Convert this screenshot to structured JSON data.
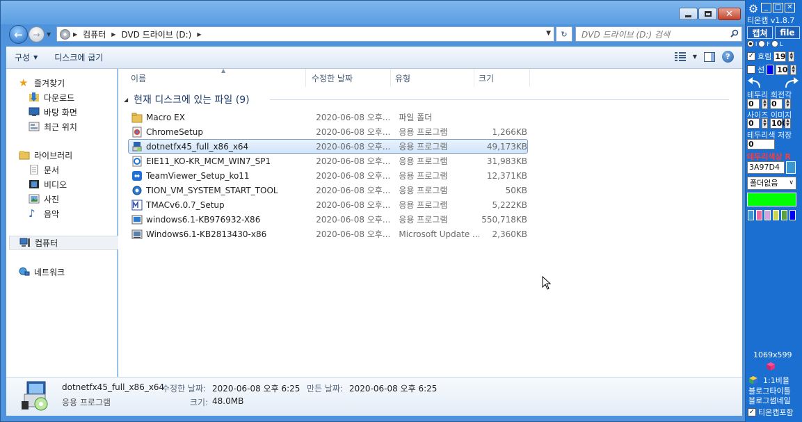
{
  "window": {
    "caption_buttons": [
      "minimize",
      "maximize",
      "close"
    ]
  },
  "address": {
    "crumbs": [
      "컴퓨터",
      "DVD 드라이브 (D:)"
    ],
    "search_placeholder": "DVD 드라이브 (D:) 검색"
  },
  "toolbar": {
    "organize": "구성",
    "burn": "디스크에 굽기"
  },
  "nav": {
    "favorites": "즐겨찾기",
    "downloads": "다운로드",
    "desktop": "바탕 화면",
    "recent": "최근 위치",
    "libraries": "라이브러리",
    "documents": "문서",
    "videos": "비디오",
    "pictures": "사진",
    "music": "음악",
    "computer": "컴퓨터",
    "network": "네트워크"
  },
  "columns": {
    "name": "이름",
    "modified": "수정한 날짜",
    "type": "유형",
    "size": "크기"
  },
  "group": {
    "title": "현재 디스크에 있는 파일 (9)"
  },
  "files": [
    {
      "name": "Macro EX",
      "date": "2020-06-08 오후...",
      "type": "파일 폴더",
      "size": "",
      "icon": "folder-icon"
    },
    {
      "name": "ChromeSetup",
      "date": "2020-06-08 오후...",
      "type": "응용 프로그램",
      "size": "1,266KB",
      "icon": "chrome-setup-icon"
    },
    {
      "name": "dotnetfx45_full_x86_x64",
      "date": "2020-06-08 오후...",
      "type": "응용 프로그램",
      "size": "49,173KB",
      "icon": "installer-icon"
    },
    {
      "name": "EIE11_KO-KR_MCM_WIN7_SP1",
      "date": "2020-06-08 오후...",
      "type": "응용 프로그램",
      "size": "31,983KB",
      "icon": "ie-setup-icon"
    },
    {
      "name": "TeamViewer_Setup_ko11",
      "date": "2020-06-08 오후...",
      "type": "응용 프로그램",
      "size": "12,371KB",
      "icon": "teamviewer-icon"
    },
    {
      "name": "TION_VM_SYSTEM_START_TOOL",
      "date": "2020-06-08 오후...",
      "type": "응용 프로그램",
      "size": "50KB",
      "icon": "gear-app-icon"
    },
    {
      "name": "TMACv6.0.7_Setup",
      "date": "2020-06-08 오후...",
      "type": "응용 프로그램",
      "size": "5,222KB",
      "icon": "tmac-icon"
    },
    {
      "name": "windows6.1-KB976932-X86",
      "date": "2020-06-08 오후...",
      "type": "응용 프로그램",
      "size": "550,718KB",
      "icon": "windows-update-icon"
    },
    {
      "name": "Windows6.1-KB2813430-x86",
      "date": "2020-06-08 오후...",
      "type": "Microsoft Update ...",
      "size": "2,360KB",
      "icon": "msu-icon"
    }
  ],
  "details": {
    "name": "dotnetfx45_full_x86_x64",
    "type": "응용 프로그램",
    "modified_label": "수정한 날짜:",
    "modified_value": "2020-06-08 오후 6:25",
    "created_label": "만든 날짜:",
    "created_value": "2020-06-08 오후 6:25",
    "size_label": "크기:",
    "size_value": "48.0MB"
  },
  "panel": {
    "title": "티온캡 v1.8.7",
    "capture_btn": "캡쳐",
    "file_btn": "file",
    "radio_labels": [
      "I",
      "F",
      "L"
    ],
    "blur_label": "흐림",
    "blur_value": "19",
    "line_label": "선",
    "line_value": "10",
    "border_rotate_label": "테두리 회전각",
    "rotate_a": "0",
    "rotate_b": "0",
    "size_image_label": "사이즈 이미지",
    "size_a": "0",
    "size_b": "100",
    "border_save_label": "테두리색 저장",
    "save_value": "0",
    "border_color_label": "테두리색상 R",
    "hex_value": "3A97D4",
    "folder_select": "폴더없음",
    "resolution": "1069x599",
    "ratio_label": "1:1비율",
    "blog_title": "블로그타이틀",
    "blog_thumb": "블로그썸네일",
    "include_label": "티온캡포함",
    "colors": {
      "hex_swatch": "#3a97d4",
      "big_swatch": "#00ff00",
      "swatches": [
        "#3a97d4",
        "#ee6aa7",
        "#cfa6e2",
        "#c9d84b",
        "#5aa43b",
        "#0000ff"
      ]
    }
  }
}
